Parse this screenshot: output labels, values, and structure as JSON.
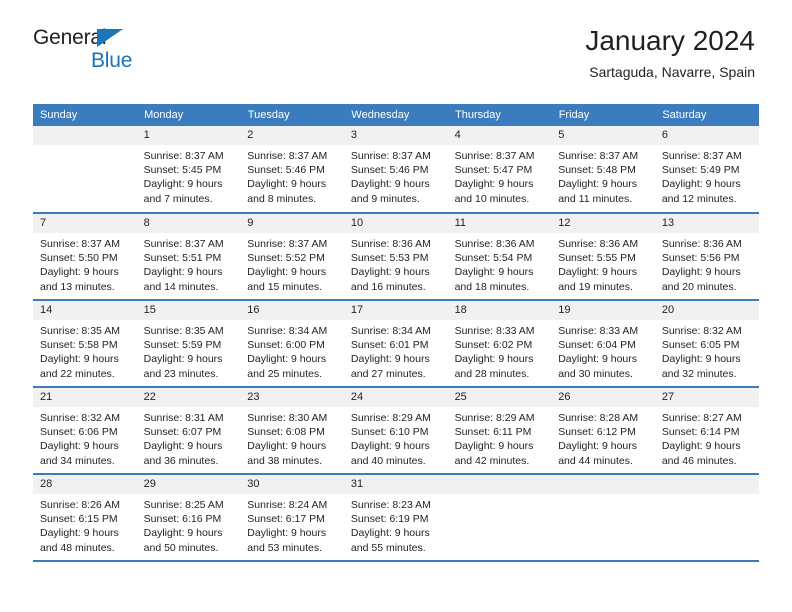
{
  "logo": {
    "word1": "General",
    "word2": "Blue",
    "triangle_color": "#1b75bb"
  },
  "header": {
    "title": "January 2024",
    "location": "Sartaguda, Navarre, Spain"
  },
  "colors": {
    "header_blue": "#3a7cbd",
    "daynum_gray": "#f1f1f1",
    "text": "#231f20"
  },
  "weekday_headers": [
    "Sunday",
    "Monday",
    "Tuesday",
    "Wednesday",
    "Thursday",
    "Friday",
    "Saturday"
  ],
  "weeks": [
    [
      {
        "day": "",
        "sunrise": "",
        "sunset": "",
        "daylight_line1": "",
        "daylight_line2": ""
      },
      {
        "day": "1",
        "sunrise": "Sunrise: 8:37 AM",
        "sunset": "Sunset: 5:45 PM",
        "daylight_line1": "Daylight: 9 hours",
        "daylight_line2": "and 7 minutes."
      },
      {
        "day": "2",
        "sunrise": "Sunrise: 8:37 AM",
        "sunset": "Sunset: 5:46 PM",
        "daylight_line1": "Daylight: 9 hours",
        "daylight_line2": "and 8 minutes."
      },
      {
        "day": "3",
        "sunrise": "Sunrise: 8:37 AM",
        "sunset": "Sunset: 5:46 PM",
        "daylight_line1": "Daylight: 9 hours",
        "daylight_line2": "and 9 minutes."
      },
      {
        "day": "4",
        "sunrise": "Sunrise: 8:37 AM",
        "sunset": "Sunset: 5:47 PM",
        "daylight_line1": "Daylight: 9 hours",
        "daylight_line2": "and 10 minutes."
      },
      {
        "day": "5",
        "sunrise": "Sunrise: 8:37 AM",
        "sunset": "Sunset: 5:48 PM",
        "daylight_line1": "Daylight: 9 hours",
        "daylight_line2": "and 11 minutes."
      },
      {
        "day": "6",
        "sunrise": "Sunrise: 8:37 AM",
        "sunset": "Sunset: 5:49 PM",
        "daylight_line1": "Daylight: 9 hours",
        "daylight_line2": "and 12 minutes."
      }
    ],
    [
      {
        "day": "7",
        "sunrise": "Sunrise: 8:37 AM",
        "sunset": "Sunset: 5:50 PM",
        "daylight_line1": "Daylight: 9 hours",
        "daylight_line2": "and 13 minutes."
      },
      {
        "day": "8",
        "sunrise": "Sunrise: 8:37 AM",
        "sunset": "Sunset: 5:51 PM",
        "daylight_line1": "Daylight: 9 hours",
        "daylight_line2": "and 14 minutes."
      },
      {
        "day": "9",
        "sunrise": "Sunrise: 8:37 AM",
        "sunset": "Sunset: 5:52 PM",
        "daylight_line1": "Daylight: 9 hours",
        "daylight_line2": "and 15 minutes."
      },
      {
        "day": "10",
        "sunrise": "Sunrise: 8:36 AM",
        "sunset": "Sunset: 5:53 PM",
        "daylight_line1": "Daylight: 9 hours",
        "daylight_line2": "and 16 minutes."
      },
      {
        "day": "11",
        "sunrise": "Sunrise: 8:36 AM",
        "sunset": "Sunset: 5:54 PM",
        "daylight_line1": "Daylight: 9 hours",
        "daylight_line2": "and 18 minutes."
      },
      {
        "day": "12",
        "sunrise": "Sunrise: 8:36 AM",
        "sunset": "Sunset: 5:55 PM",
        "daylight_line1": "Daylight: 9 hours",
        "daylight_line2": "and 19 minutes."
      },
      {
        "day": "13",
        "sunrise": "Sunrise: 8:36 AM",
        "sunset": "Sunset: 5:56 PM",
        "daylight_line1": "Daylight: 9 hours",
        "daylight_line2": "and 20 minutes."
      }
    ],
    [
      {
        "day": "14",
        "sunrise": "Sunrise: 8:35 AM",
        "sunset": "Sunset: 5:58 PM",
        "daylight_line1": "Daylight: 9 hours",
        "daylight_line2": "and 22 minutes."
      },
      {
        "day": "15",
        "sunrise": "Sunrise: 8:35 AM",
        "sunset": "Sunset: 5:59 PM",
        "daylight_line1": "Daylight: 9 hours",
        "daylight_line2": "and 23 minutes."
      },
      {
        "day": "16",
        "sunrise": "Sunrise: 8:34 AM",
        "sunset": "Sunset: 6:00 PM",
        "daylight_line1": "Daylight: 9 hours",
        "daylight_line2": "and 25 minutes."
      },
      {
        "day": "17",
        "sunrise": "Sunrise: 8:34 AM",
        "sunset": "Sunset: 6:01 PM",
        "daylight_line1": "Daylight: 9 hours",
        "daylight_line2": "and 27 minutes."
      },
      {
        "day": "18",
        "sunrise": "Sunrise: 8:33 AM",
        "sunset": "Sunset: 6:02 PM",
        "daylight_line1": "Daylight: 9 hours",
        "daylight_line2": "and 28 minutes."
      },
      {
        "day": "19",
        "sunrise": "Sunrise: 8:33 AM",
        "sunset": "Sunset: 6:04 PM",
        "daylight_line1": "Daylight: 9 hours",
        "daylight_line2": "and 30 minutes."
      },
      {
        "day": "20",
        "sunrise": "Sunrise: 8:32 AM",
        "sunset": "Sunset: 6:05 PM",
        "daylight_line1": "Daylight: 9 hours",
        "daylight_line2": "and 32 minutes."
      }
    ],
    [
      {
        "day": "21",
        "sunrise": "Sunrise: 8:32 AM",
        "sunset": "Sunset: 6:06 PM",
        "daylight_line1": "Daylight: 9 hours",
        "daylight_line2": "and 34 minutes."
      },
      {
        "day": "22",
        "sunrise": "Sunrise: 8:31 AM",
        "sunset": "Sunset: 6:07 PM",
        "daylight_line1": "Daylight: 9 hours",
        "daylight_line2": "and 36 minutes."
      },
      {
        "day": "23",
        "sunrise": "Sunrise: 8:30 AM",
        "sunset": "Sunset: 6:08 PM",
        "daylight_line1": "Daylight: 9 hours",
        "daylight_line2": "and 38 minutes."
      },
      {
        "day": "24",
        "sunrise": "Sunrise: 8:29 AM",
        "sunset": "Sunset: 6:10 PM",
        "daylight_line1": "Daylight: 9 hours",
        "daylight_line2": "and 40 minutes."
      },
      {
        "day": "25",
        "sunrise": "Sunrise: 8:29 AM",
        "sunset": "Sunset: 6:11 PM",
        "daylight_line1": "Daylight: 9 hours",
        "daylight_line2": "and 42 minutes."
      },
      {
        "day": "26",
        "sunrise": "Sunrise: 8:28 AM",
        "sunset": "Sunset: 6:12 PM",
        "daylight_line1": "Daylight: 9 hours",
        "daylight_line2": "and 44 minutes."
      },
      {
        "day": "27",
        "sunrise": "Sunrise: 8:27 AM",
        "sunset": "Sunset: 6:14 PM",
        "daylight_line1": "Daylight: 9 hours",
        "daylight_line2": "and 46 minutes."
      }
    ],
    [
      {
        "day": "28",
        "sunrise": "Sunrise: 8:26 AM",
        "sunset": "Sunset: 6:15 PM",
        "daylight_line1": "Daylight: 9 hours",
        "daylight_line2": "and 48 minutes."
      },
      {
        "day": "29",
        "sunrise": "Sunrise: 8:25 AM",
        "sunset": "Sunset: 6:16 PM",
        "daylight_line1": "Daylight: 9 hours",
        "daylight_line2": "and 50 minutes."
      },
      {
        "day": "30",
        "sunrise": "Sunrise: 8:24 AM",
        "sunset": "Sunset: 6:17 PM",
        "daylight_line1": "Daylight: 9 hours",
        "daylight_line2": "and 53 minutes."
      },
      {
        "day": "31",
        "sunrise": "Sunrise: 8:23 AM",
        "sunset": "Sunset: 6:19 PM",
        "daylight_line1": "Daylight: 9 hours",
        "daylight_line2": "and 55 minutes."
      },
      {
        "day": "",
        "sunrise": "",
        "sunset": "",
        "daylight_line1": "",
        "daylight_line2": ""
      },
      {
        "day": "",
        "sunrise": "",
        "sunset": "",
        "daylight_line1": "",
        "daylight_line2": ""
      },
      {
        "day": "",
        "sunrise": "",
        "sunset": "",
        "daylight_line1": "",
        "daylight_line2": ""
      }
    ]
  ]
}
